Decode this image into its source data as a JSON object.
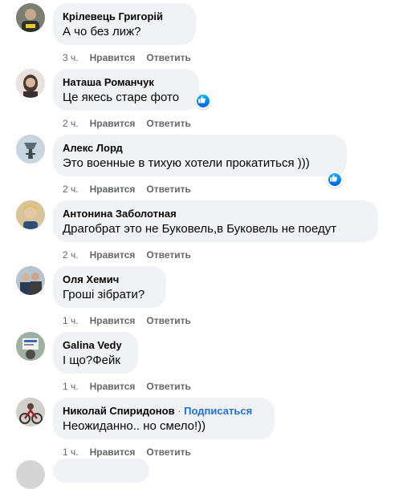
{
  "comments": [
    {
      "author": "Крілевець Григорій",
      "text": "А чо без лиж?",
      "time": "3 ч.",
      "like": "Нравится",
      "reply": "Ответить"
    },
    {
      "author": "Наташа Романчук",
      "text": "Це якесь старе фото",
      "time": "2 ч.",
      "like": "Нравится",
      "reply": "Ответить",
      "reaction": "like-reaction-icon"
    },
    {
      "author": "Алекс Лорд",
      "text": "Это военные в тихую хотели прокатиться )))",
      "time": "2 ч.",
      "like": "Нравится",
      "reply": "Ответить",
      "reaction": "like-reaction-icon"
    },
    {
      "author": "Антонина Заболотная",
      "text": "Драгобрат это не Буковель,в Буковель не поедут",
      "time": "2 ч.",
      "like": "Нравится",
      "reply": "Ответить"
    },
    {
      "author": "Оля Хемич",
      "text": "Гроші зібрати?",
      "time": "1 ч.",
      "like": "Нравится",
      "reply": "Ответить"
    },
    {
      "author": "Galina Vedy",
      "text": "І що?Фейк",
      "time": "1 ч.",
      "like": "Нравится",
      "reply": "Ответить"
    },
    {
      "author": "Николай Спиридонов",
      "separator": "·",
      "subscribe": "Подписаться",
      "text": "Неожиданно.. но смело!))",
      "time": "1 ч.",
      "like": "Нравится",
      "reply": "Ответить"
    }
  ],
  "colors": {
    "bubble": "#f0f2f5",
    "secondary_text": "#65676b",
    "link": "#216fdb",
    "like_blue": "#0a7cff"
  }
}
